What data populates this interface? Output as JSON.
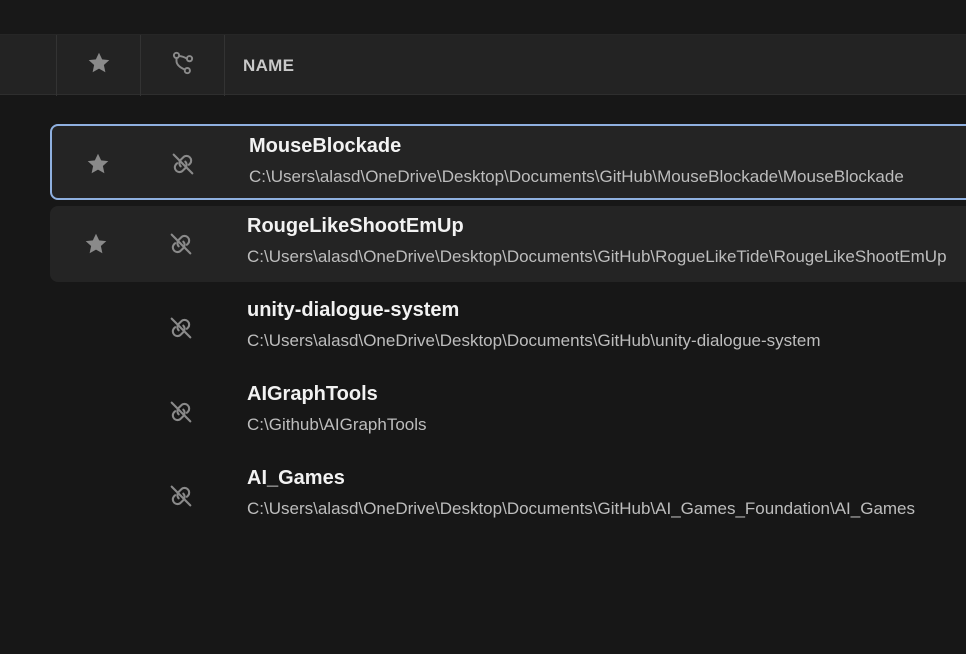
{
  "header": {
    "star_icon": "star-icon",
    "branch_icon": "branch-icon",
    "name_label": "NAME"
  },
  "projects": [
    {
      "name": "MouseBlockade",
      "path": "C:\\Users\\alasd\\OneDrive\\Desktop\\Documents\\GitHub\\MouseBlockade\\MouseBlockade",
      "favorite": true,
      "state": "selected"
    },
    {
      "name": "RougeLikeShootEmUp",
      "path": "C:\\Users\\alasd\\OneDrive\\Desktop\\Documents\\GitHub\\RogueLikeTide\\RougeLikeShootEmUp",
      "favorite": true,
      "state": "hover"
    },
    {
      "name": "unity-dialogue-system",
      "path": "C:\\Users\\alasd\\OneDrive\\Desktop\\Documents\\GitHub\\unity-dialogue-system",
      "favorite": false,
      "state": "normal"
    },
    {
      "name": "AIGraphTools",
      "path": "C:\\Github\\AIGraphTools",
      "favorite": false,
      "state": "normal"
    },
    {
      "name": "AI_Games",
      "path": "C:\\Users\\alasd\\OneDrive\\Desktop\\Documents\\GitHub\\AI_Games_Foundation\\AI_Games",
      "favorite": false,
      "state": "normal"
    }
  ],
  "colors": {
    "background": "#171717",
    "header": "#232323",
    "selected_border": "#8fb0e0",
    "icon": "#8a8a8a"
  }
}
